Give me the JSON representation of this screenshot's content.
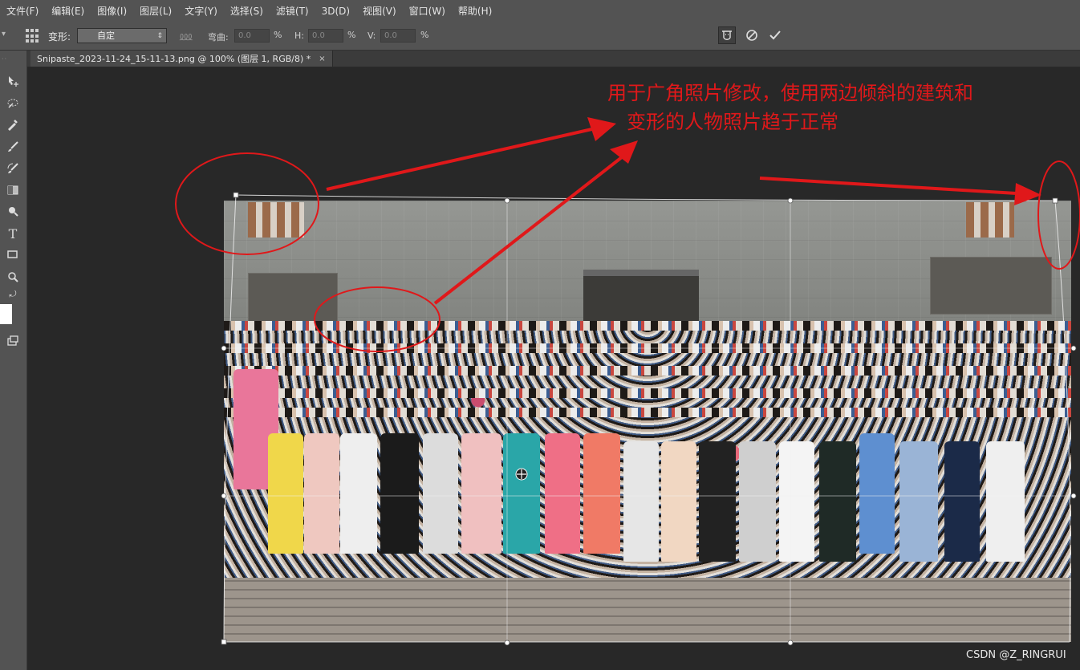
{
  "menu": [
    "文件(F)",
    "编辑(E)",
    "图像(I)",
    "图层(L)",
    "文字(Y)",
    "选择(S)",
    "滤镜(T)",
    "3D(D)",
    "视图(V)",
    "窗口(W)",
    "帮助(H)"
  ],
  "options": {
    "warp_label": "变形:",
    "warp_value": "自定",
    "bend_label": "弯曲:",
    "bend_value": "0.0",
    "h_label": "H:",
    "h_value": "0.0",
    "v_label": "V:",
    "v_value": "0.0",
    "percent": "%"
  },
  "document": {
    "tab_title": "Snipaste_2023-11-24_15-11-13.png @ 100% (图层 1, RGB/8) *",
    "close": "×"
  },
  "toolbar_icons": [
    "move-icon",
    "quick-selection-icon",
    "eyedropper-icon",
    "brush-icon",
    "history-brush-icon",
    "gradient-icon",
    "dodge-icon",
    "type-icon",
    "rectangle-icon",
    "zoom-icon",
    "swap-colors-icon",
    "screen-mode-icon"
  ],
  "annotation": {
    "line1": "用于广角照片修改，使用两边倾斜的建筑和",
    "line2": "变形的人物照片趋于正常",
    "color": "#e0181a"
  },
  "watermark": "CSDN @Z_RINGRUI"
}
